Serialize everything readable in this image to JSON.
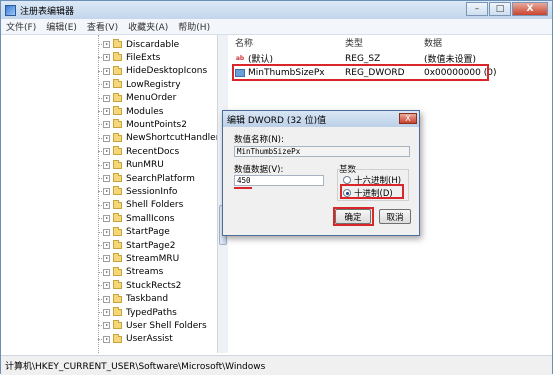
{
  "window": {
    "title": "注册表编辑器",
    "controls": {
      "minimize": "–",
      "maximize": "□",
      "close": "X"
    }
  },
  "menu": [
    "文件(F)",
    "编辑(E)",
    "查看(V)",
    "收藏夹(A)",
    "帮助(H)"
  ],
  "tree": {
    "items": [
      "Discardable",
      "FileExts",
      "HideDesktopIcons",
      "LowRegistry",
      "MenuOrder",
      "Modules",
      "MountPoints2",
      "NewShortcutHandlers",
      "RecentDocs",
      "RunMRU",
      "SearchPlatform",
      "SessionInfo",
      "Shell Folders",
      "SmallIcons",
      "StartPage",
      "StartPage2",
      "StreamMRU",
      "Streams",
      "StuckRects2",
      "Taskband",
      "TypedPaths",
      "User Shell Folders",
      "UserAssist"
    ]
  },
  "list": {
    "headers": {
      "name": "名称",
      "type": "类型",
      "data": "数据"
    },
    "rows": [
      {
        "icon": "string-value-icon",
        "name": "(默认)",
        "type": "REG_SZ",
        "data": "(数值未设置)"
      },
      {
        "icon": "binary-value-icon",
        "name": "MinThumbSizePx",
        "type": "REG_DWORD",
        "data": "0x00000000 (0)"
      }
    ]
  },
  "status": {
    "path": "计算机\\HKEY_CURRENT_USER\\Software\\Microsoft\\Windows"
  },
  "dialog": {
    "title": "编辑 DWORD (32 位)值",
    "close": "X",
    "value_name_label": "数值名称(N):",
    "value_name": "MinThumbSizePx",
    "value_data_label": "数值数据(V):",
    "value_data": "450",
    "base_label": "基数",
    "radio_hex": "十六进制(H)",
    "radio_dec": "十进制(D)",
    "selected_base": "decimal",
    "ok": "确定",
    "cancel": "取消"
  },
  "colors": {
    "highlight": "#d9262b",
    "titlebar": "#c3d6ec"
  }
}
